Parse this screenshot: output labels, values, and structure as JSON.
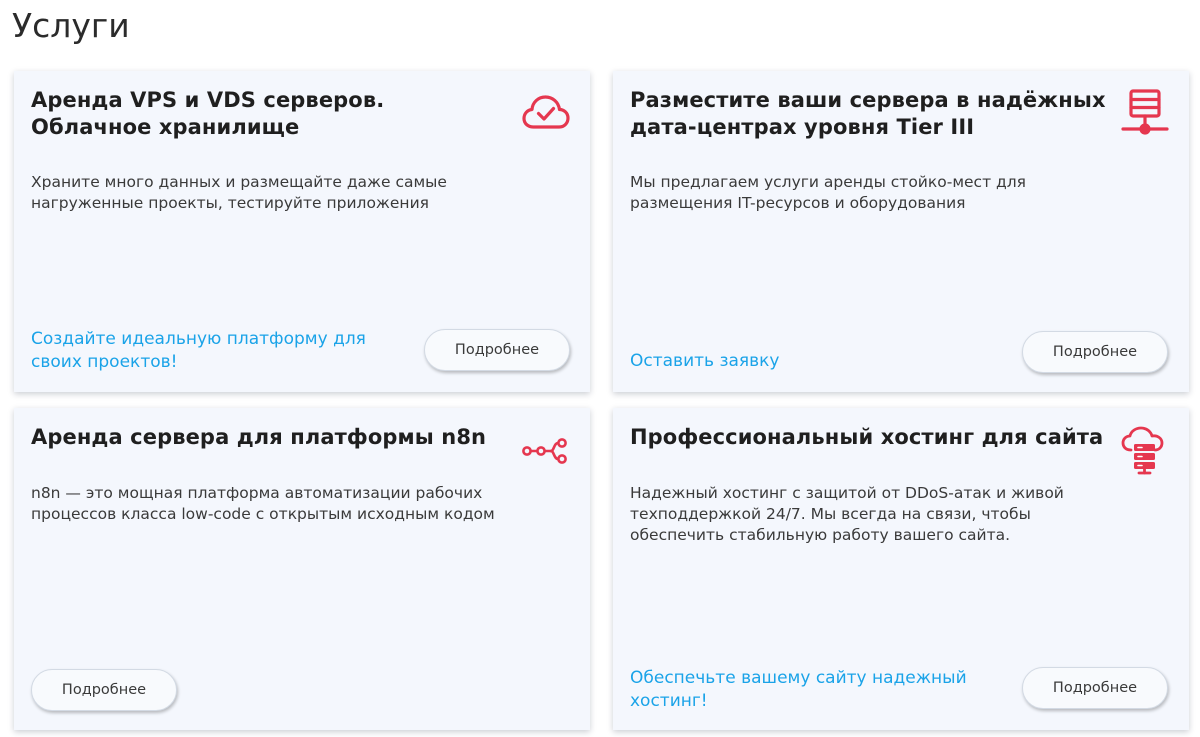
{
  "page": {
    "title": "Услуги"
  },
  "colors": {
    "accent_icon": "#e5374f",
    "link": "#1aa3e8",
    "card_bg": "#f4f7fd"
  },
  "cards": [
    {
      "title": "Аренда VPS и VDS серверов. Облачное хранилище",
      "description": "Храните много данных и размещайте даже самые нагруженные проекты, тестируйте приложения",
      "link_text": "Создайте идеальную платформу для своих проектов!",
      "button_label": "Подробнее",
      "icon": "cloud-check-icon"
    },
    {
      "title": "Разместите ваши сервера в надёжных дата-центрах уровня Tier III",
      "description": "Мы предлагаем услуги аренды стойко-мест для размещения IT-ресурсов и оборудования",
      "link_text": "Оставить заявку",
      "button_label": "Подробнее",
      "icon": "server-network-icon"
    },
    {
      "title": "Аренда сервера для платформы n8n",
      "description": "n8n — это мощная платформа автоматизации рабочих процессов класса low-code с открытым исходным кодом",
      "button_label": "Подробнее",
      "icon": "workflow-nodes-icon"
    },
    {
      "title": "Профессиональный хостинг для сайта",
      "description": "Надежный хостинг с защитой от DDoS-атак и живой техподдержкой 24/7. Мы всегда на связи, чтобы обеспечить стабильную работу вашего сайта.",
      "link_text": "Обеспечьте вашему сайту надежный хостинг!",
      "button_label": "Подробнее",
      "icon": "cloud-server-icon"
    }
  ]
}
